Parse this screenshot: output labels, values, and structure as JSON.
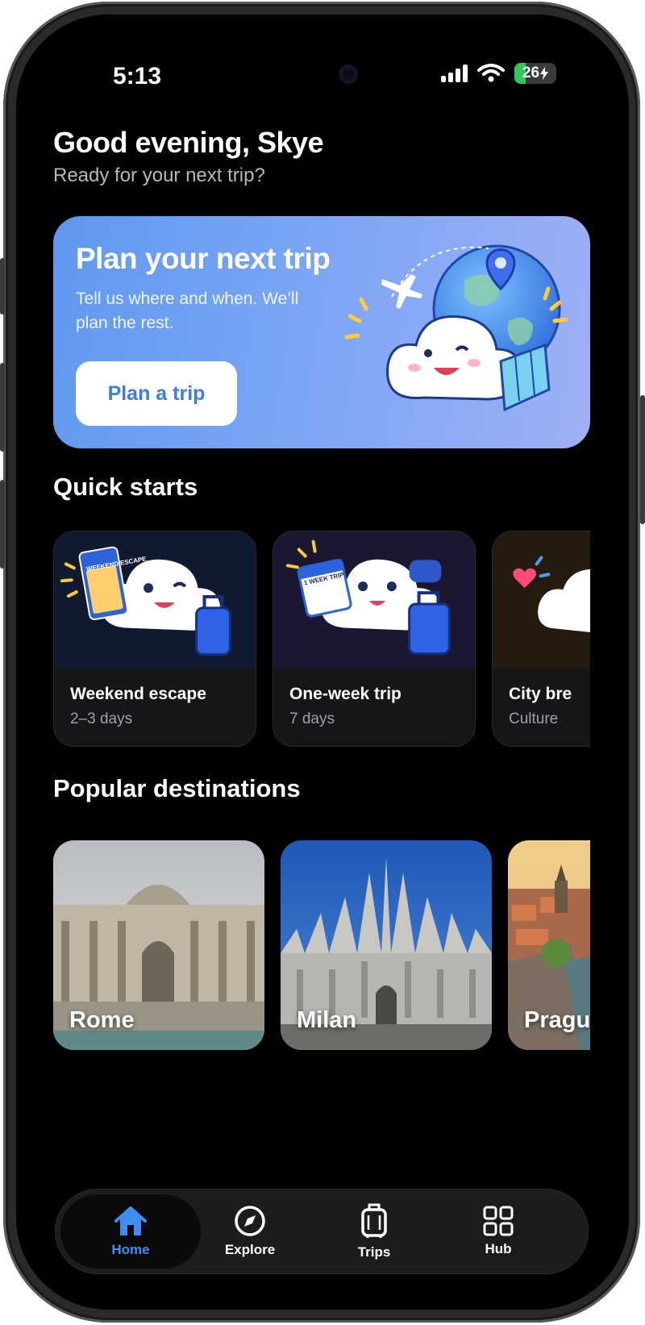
{
  "status_bar": {
    "time": "5:13",
    "battery": "26",
    "battery_level": 0.26
  },
  "greeting": {
    "title": "Good evening, Skye",
    "subtitle": "Ready for your next trip?"
  },
  "hero": {
    "title": "Plan your next trip",
    "subtitle": "Tell us where and when. We’ll plan the rest.",
    "button_label": "Plan a trip"
  },
  "quick_starts": {
    "title": "Quick starts",
    "cards": [
      {
        "label": "Weekend escape",
        "sub": "2–3 days",
        "ticket_text": "WEEKEND ESCAPE"
      },
      {
        "label": "One-week trip",
        "sub": "7 days",
        "ticket_text": "1 WEEK TRIP"
      },
      {
        "label": "City bre",
        "sub": "Culture"
      }
    ]
  },
  "popular": {
    "title": "Popular destinations",
    "cards": [
      {
        "name": "Rome"
      },
      {
        "name": "Milan"
      },
      {
        "name": "Pragu"
      }
    ]
  },
  "tabs": [
    {
      "label": "Home",
      "icon": "home-icon",
      "active": true
    },
    {
      "label": "Explore",
      "icon": "compass-icon",
      "active": false
    },
    {
      "label": "Trips",
      "icon": "suitcase-icon",
      "active": false
    },
    {
      "label": "Hub",
      "icon": "grid-icon",
      "active": false
    }
  ],
  "colors": {
    "accent": "#3f8cf2",
    "hero_gradient_start": "#5f98ef",
    "hero_gradient_end": "#9fb0f6",
    "background": "#000000"
  }
}
